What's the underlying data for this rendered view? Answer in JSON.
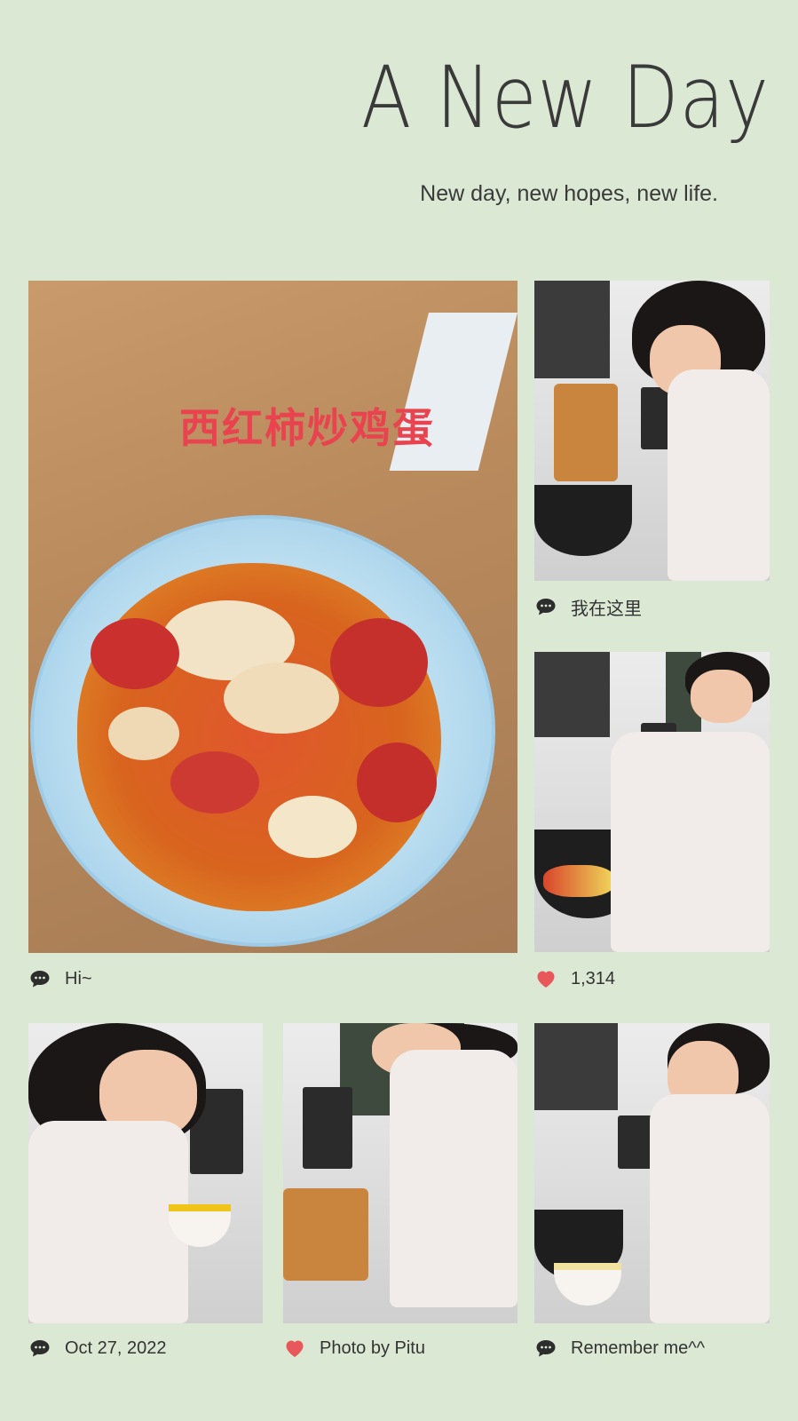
{
  "header": {
    "title": "A New Day",
    "subtitle": "New day, new hopes, new life."
  },
  "photos": {
    "main": {
      "overlay_text": "西红柿炒鸡蛋"
    }
  },
  "captions": [
    {
      "icon": "comment-icon",
      "text": "Hi~"
    },
    {
      "icon": "comment-icon",
      "text": "我在这里"
    },
    {
      "icon": "heart-icon",
      "text": "1,314"
    },
    {
      "icon": "comment-icon",
      "text": "Oct 27, 2022"
    },
    {
      "icon": "heart-icon",
      "text": "Photo by Pitu"
    },
    {
      "icon": "comment-icon",
      "text": "Remember me^^"
    }
  ],
  "colors": {
    "background": "#dbe9d4",
    "heart": "#e8575a",
    "icon": "#2d2d2d",
    "dish_label": "#e8434e"
  }
}
